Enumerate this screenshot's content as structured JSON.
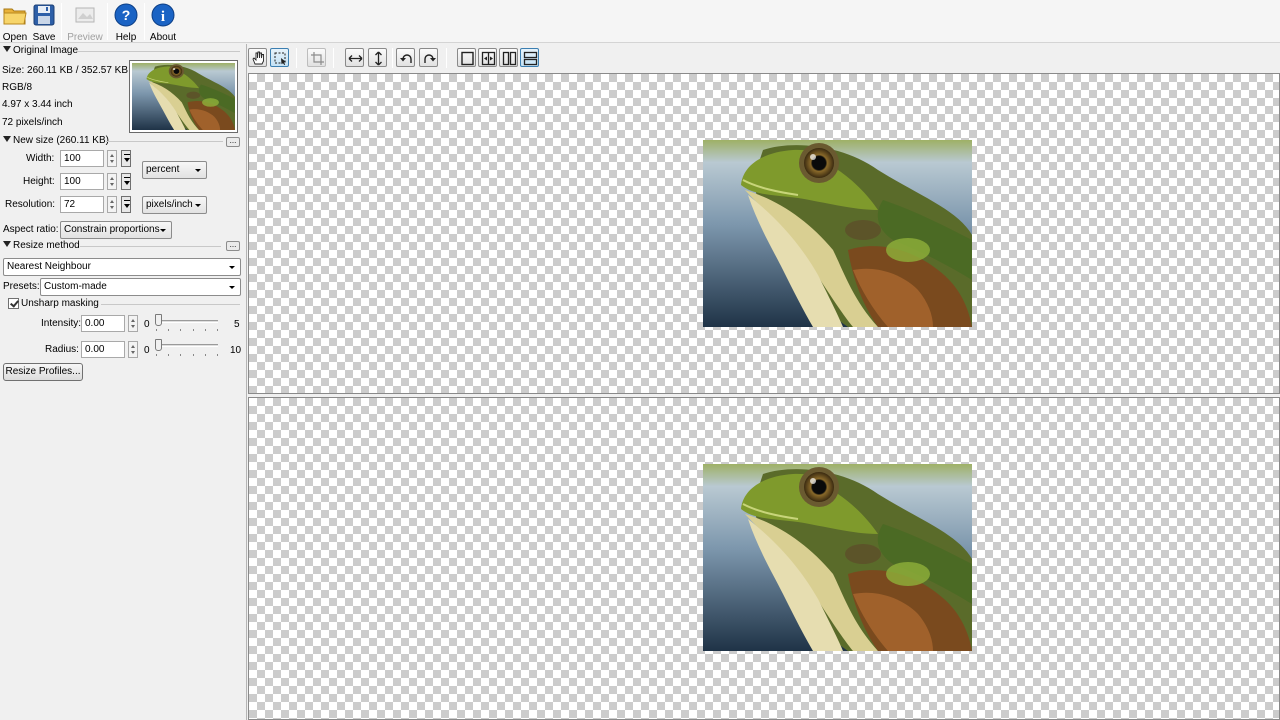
{
  "toolbar": {
    "open_label": "Open",
    "save_label": "Save",
    "preview_label": "Preview",
    "help_label": "Help",
    "about_label": "About"
  },
  "original_image": {
    "header": "Original Image",
    "size": "Size: 260.11 KB / 352.57 KB",
    "mode": "RGB/8",
    "dimensions": "4.97 x 3.44 inch",
    "resolution": "72 pixels/inch"
  },
  "new_size": {
    "header": "New size (260.11 KB)",
    "width_label": "Width:",
    "width_value": "100",
    "height_label": "Height:",
    "height_value": "100",
    "unit": "percent",
    "resolution_label": "Resolution:",
    "resolution_value": "72",
    "resolution_unit": "pixels/inch",
    "aspect_label": "Aspect ratio:",
    "aspect_value": "Constrain proportions"
  },
  "resize_method": {
    "header": "Resize method",
    "method": "Nearest Neighbour",
    "presets_label": "Presets:",
    "presets_value": "Custom-made"
  },
  "unsharp": {
    "label": "Unsharp masking",
    "checked": true,
    "intensity_label": "Intensity:",
    "intensity_value": "0.00",
    "intensity_min": "0",
    "intensity_max": "5",
    "intensity_level": 0,
    "radius_label": "Radius:",
    "radius_value": "0.00",
    "radius_min": "0",
    "radius_max": "10",
    "radius_level": 0
  },
  "resize_profiles_label": "Resize Profiles...",
  "ellipsis_label": "...",
  "colors": {
    "help_blue": "#1a63c4",
    "active_button": "#c4e2f5"
  }
}
